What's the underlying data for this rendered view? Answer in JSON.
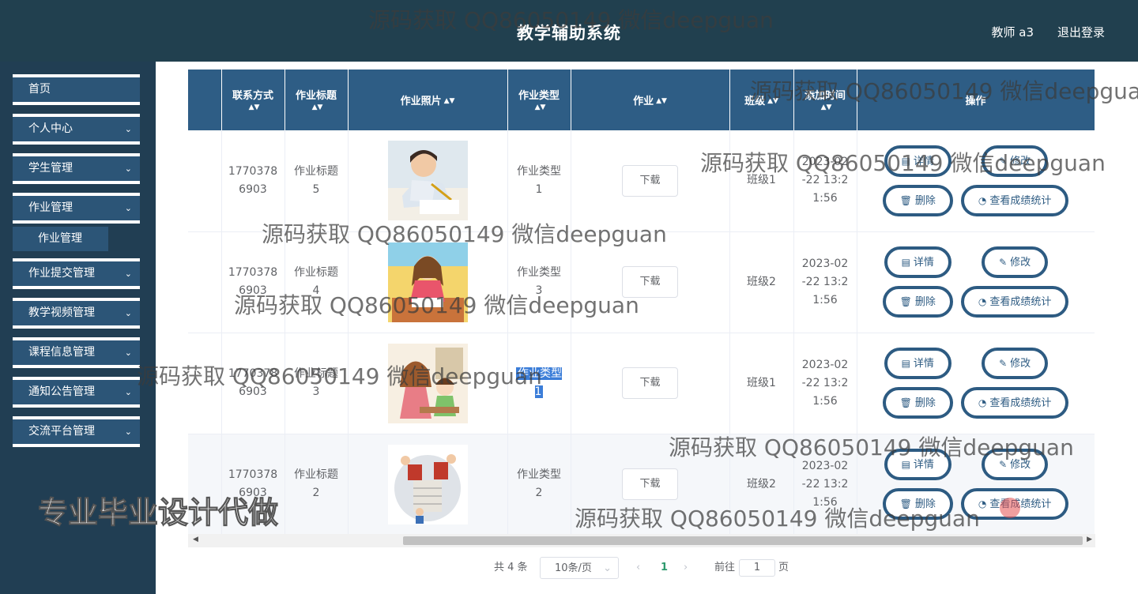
{
  "header": {
    "title": "教学辅助系统",
    "user": "教师 a3",
    "logout": "退出登录"
  },
  "sidebar": {
    "items": [
      {
        "label": "首页"
      },
      {
        "label": "个人中心",
        "chevron": "⌄"
      },
      {
        "label": "学生管理",
        "chevron": "⌄"
      },
      {
        "label": "作业管理",
        "chevron": "⌄"
      },
      {
        "label": "作业提交管理",
        "chevron": "⌄"
      },
      {
        "label": "教学视频管理",
        "chevron": "⌄"
      },
      {
        "label": "课程信息管理",
        "chevron": "⌄"
      },
      {
        "label": "通知公告管理",
        "chevron": "⌄"
      },
      {
        "label": "交流平台管理",
        "chevron": "⌄"
      }
    ],
    "sub_item": "作业管理"
  },
  "table": {
    "columns": {
      "contact": "联系方式",
      "title": "作业标题",
      "photo": "作业照片",
      "type": "作业类型",
      "homework": "作业",
      "class": "班级",
      "time": "添加时间",
      "ops": "操作"
    },
    "sort_icon": "▲▼",
    "rows": [
      {
        "contact": "17703786903",
        "title": "作业标题5",
        "type": "作业类型1",
        "download": "下载",
        "class": "班级1",
        "time": "2023-02-22 13:21:56"
      },
      {
        "contact": "17703786903",
        "title": "作业标题4",
        "type": "作业类型3",
        "download": "下载",
        "class": "班级2",
        "time": "2023-02-22 13:21:56"
      },
      {
        "contact": "17703786903",
        "title": "作业标题3",
        "type": "作业类型1",
        "download": "下载",
        "class": "班级1",
        "time": "2023-02-22 13:21:56"
      },
      {
        "contact": "17703786903",
        "title": "作业标题2",
        "type": "作业类型2",
        "download": "下载",
        "class": "班级2",
        "time": "2023-02-22 13:21:56"
      }
    ],
    "ops": {
      "detail": "详情",
      "edit": "修改",
      "delete": "删除",
      "stats": "查看成绩统计"
    }
  },
  "pagination": {
    "total": "共 4 条",
    "page_size": "10条/页",
    "current": "1",
    "goto": "前往",
    "goto_value": "1",
    "page_unit": "页"
  },
  "watermarks": {
    "text": "源码获取 QQ86050149 微信deepguan",
    "big": "专业毕业设计代做"
  },
  "colors": {
    "header": "#21404f",
    "sidebar": "#213e53",
    "menu": "#2c5577",
    "table_head": "#2e5d85",
    "button_border": "#2d5b82"
  }
}
